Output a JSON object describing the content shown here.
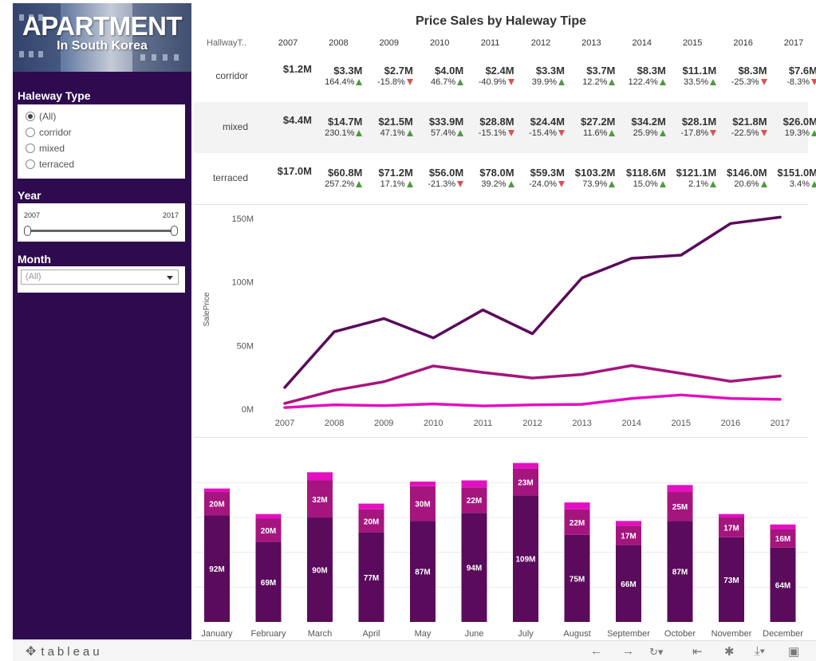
{
  "banner": {
    "title": "APARTMENT",
    "subtitle": "In South Korea"
  },
  "filters": {
    "haleway": {
      "title": "Haleway Type",
      "options": [
        "(All)",
        "corridor",
        "mixed",
        "terraced"
      ],
      "selected": "(All)"
    },
    "year": {
      "title": "Year",
      "min_label": "2007",
      "max_label": "2017"
    },
    "month": {
      "title": "Month",
      "value": "(All)"
    }
  },
  "table": {
    "title": "Price Sales by Haleway Tipe",
    "corner_header": "HallwayT..",
    "years": [
      "2007",
      "2008",
      "2009",
      "2010",
      "2011",
      "2012",
      "2013",
      "2014",
      "2015",
      "2016",
      "2017"
    ],
    "rows": [
      {
        "label": "corridor",
        "values": [
          "$1.2M",
          "$3.3M",
          "$2.7M",
          "$4.0M",
          "$2.4M",
          "$3.3M",
          "$3.7M",
          "$8.3M",
          "$11.1M",
          "$8.3M",
          "$7.6M"
        ],
        "pct": [
          "",
          "164.4%",
          "-15.8%",
          "46.7%",
          "-40.9%",
          "39.9%",
          "12.2%",
          "122.4%",
          "33.5%",
          "-25.3%",
          "-8.3%"
        ],
        "dir": [
          "",
          "up",
          "down",
          "up",
          "down",
          "up",
          "up",
          "up",
          "up",
          "down",
          "down"
        ]
      },
      {
        "label": "mixed",
        "values": [
          "$4.4M",
          "$14.7M",
          "$21.5M",
          "$33.9M",
          "$28.8M",
          "$24.4M",
          "$27.2M",
          "$34.2M",
          "$28.1M",
          "$21.8M",
          "$26.0M"
        ],
        "pct": [
          "",
          "230.1%",
          "47.1%",
          "57.4%",
          "-15.1%",
          "-15.4%",
          "11.6%",
          "25.9%",
          "-17.8%",
          "-22.5%",
          "19.3%"
        ],
        "dir": [
          "",
          "up",
          "up",
          "up",
          "down",
          "down",
          "up",
          "up",
          "down",
          "down",
          "up"
        ]
      },
      {
        "label": "terraced",
        "values": [
          "$17.0M",
          "$60.8M",
          "$71.2M",
          "$56.0M",
          "$78.0M",
          "$59.3M",
          "$103.2M",
          "$118.6M",
          "$121.1M",
          "$146.0M",
          "$151.0M"
        ],
        "pct": [
          "",
          "257.2%",
          "17.1%",
          "-21.3%",
          "39.2%",
          "-24.0%",
          "73.9%",
          "15.0%",
          "2.1%",
          "20.6%",
          "3.4%"
        ],
        "dir": [
          "",
          "up",
          "up",
          "down",
          "up",
          "down",
          "up",
          "up",
          "up",
          "up",
          "up"
        ]
      }
    ],
    "colors": {
      "up": "#4c9a3e",
      "down": "#d9534f"
    }
  },
  "chart_data": [
    {
      "type": "line",
      "title": "",
      "xlabel": "",
      "ylabel": "SalePrice",
      "x": [
        "2007",
        "2008",
        "2009",
        "2010",
        "2011",
        "2012",
        "2013",
        "2014",
        "2015",
        "2016",
        "2017"
      ],
      "ylim": [
        0,
        160
      ],
      "y_ticks": [
        0,
        50,
        100,
        150
      ],
      "y_tick_labels": [
        "0M",
        "50M",
        "100M",
        "150M"
      ],
      "unit": "M",
      "grid": false,
      "series": [
        {
          "values": [
            17.0,
            60.8,
            71.2,
            56.0,
            78.0,
            59.3,
            103.2,
            118.6,
            121.1,
            146.0,
            151.0
          ],
          "color": "#5a0b5c"
        },
        {
          "values": [
            4.4,
            14.7,
            21.5,
            33.9,
            28.8,
            24.4,
            27.2,
            34.2,
            28.1,
            21.8,
            26.0
          ],
          "color": "#a5157e"
        },
        {
          "values": [
            1.2,
            3.3,
            2.7,
            4.0,
            2.4,
            3.3,
            3.7,
            8.3,
            11.1,
            8.3,
            7.6
          ],
          "color": "#e30fc1"
        }
      ]
    },
    {
      "type": "bar",
      "stacked": true,
      "categories": [
        "January",
        "February",
        "March",
        "April",
        "May",
        "June",
        "July",
        "August",
        "September",
        "October",
        "November",
        "December"
      ],
      "grid": true,
      "ylim": [
        0,
        140
      ],
      "series": [
        {
          "values": [
            92,
            69,
            90,
            77,
            87,
            94,
            109,
            75,
            66,
            87,
            73,
            64
          ],
          "labels": [
            "92M",
            "69M",
            "90M",
            "77M",
            "87M",
            "94M",
            "109M",
            "75M",
            "66M",
            "87M",
            "73M",
            "64M"
          ],
          "color": "#5a0b5c"
        },
        {
          "values": [
            20,
            20,
            32,
            20,
            30,
            22,
            23,
            22,
            17,
            25,
            17,
            16
          ],
          "labels": [
            "20M",
            "20M",
            "32M",
            "20M",
            "30M",
            "22M",
            "23M",
            "22M",
            "17M",
            "25M",
            "17M",
            "16M"
          ],
          "color": "#a5157e"
        },
        {
          "values": [
            3,
            4,
            7,
            5,
            4,
            6,
            5,
            6,
            4,
            6,
            3,
            4
          ],
          "color": "#e30fc1"
        }
      ]
    }
  ],
  "footer": {
    "brand": "tableau"
  }
}
